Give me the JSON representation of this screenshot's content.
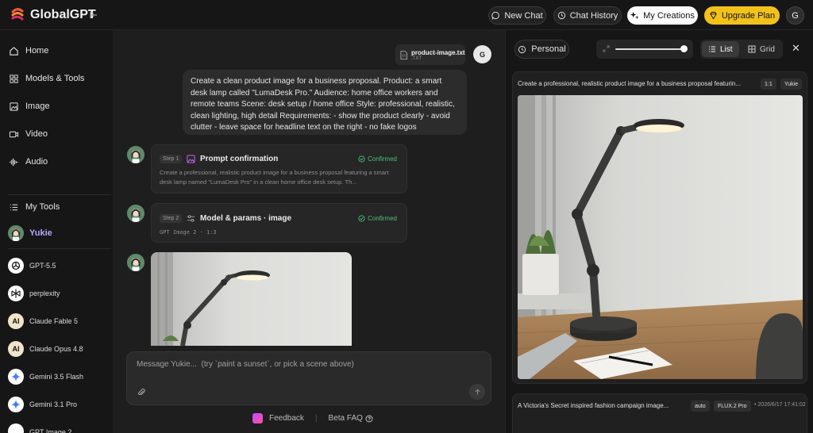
{
  "app": {
    "name": "GlobalGPT"
  },
  "topbar": {
    "new_chat": "New Chat",
    "chat_history": "Chat History",
    "my_creations": "My Creations",
    "upgrade_plan": "Upgrade Plan",
    "avatar_initial": "G"
  },
  "sidebar": {
    "nav": [
      {
        "label": "Home",
        "icon": "home-icon"
      },
      {
        "label": "Models & Tools",
        "icon": "grid-icon"
      },
      {
        "label": "Image",
        "icon": "image-icon"
      },
      {
        "label": "Video",
        "icon": "video-icon"
      },
      {
        "label": "Audio",
        "icon": "audio-icon"
      }
    ],
    "my_tools": "My Tools",
    "active_tool": "Yukie",
    "models": [
      {
        "label": "GPT-5.5",
        "icon": "openai-icon"
      },
      {
        "label": "perplexity",
        "icon": "perplexity-icon"
      },
      {
        "label": "Claude Fable 5",
        "icon": "anthropic-icon"
      },
      {
        "label": "Claude Opus 4.8",
        "icon": "anthropic-icon"
      },
      {
        "label": "Gemini 3.5 Flash",
        "icon": "gemini-icon"
      },
      {
        "label": "Gemini 3.1 Pro",
        "icon": "gemini-icon"
      },
      {
        "label": "GPT Image 2",
        "icon": "openai-icon"
      }
    ]
  },
  "chat": {
    "file": {
      "name": "product-image.txt",
      "ext": ".TXT"
    },
    "user_initial": "G",
    "user_message": "Create a clean product image for a business proposal. Product: a smart desk lamp called \"LumaDesk Pro.\" Audience: home office workers and remote teams Scene: desk setup / home office Style: professional, realistic, clean lighting, high detail Requirements: - show the product clearly - avoid clutter - leave space for headline text on the right - no fake logos",
    "steps": [
      {
        "pill": "Step 1",
        "title": "Prompt confirmation",
        "status": "Confirmed",
        "desc": "Create a professional, realistic product image for a business proposal featuring a smart desk lamp named \"LumaDesk Pro\" in a clean home office desk setup. Th..."
      },
      {
        "pill": "Step 2",
        "title": "Model & params · image",
        "status": "Confirmed",
        "desc": "GPT Image 2 · 1:3"
      }
    ],
    "composer_placeholder": "Message Yukie...  (try `paint a sunset`, or pick a scene above)",
    "feedback": "Feedback",
    "beta_faq": "Beta FAQ"
  },
  "panel": {
    "personal": "Personal",
    "zoom_level": 1.0,
    "view_list": "List",
    "view_grid": "Grid",
    "cards": [
      {
        "title": "Create a professional, realistic product image for a business proposal featurin...",
        "ratio": "1:1",
        "agent": "Yukie"
      },
      {
        "title": "A Victoria's Secret inspired fashion campaign image...",
        "ratio": "auto",
        "model": "FLUX.2 Pro",
        "date": "2026/6/17 17:41:02"
      }
    ]
  },
  "colors": {
    "accent_yellow": "#f2c21b",
    "confirmed_green": "#4cc07a",
    "active_tool_purple": "#b9a6ff"
  }
}
